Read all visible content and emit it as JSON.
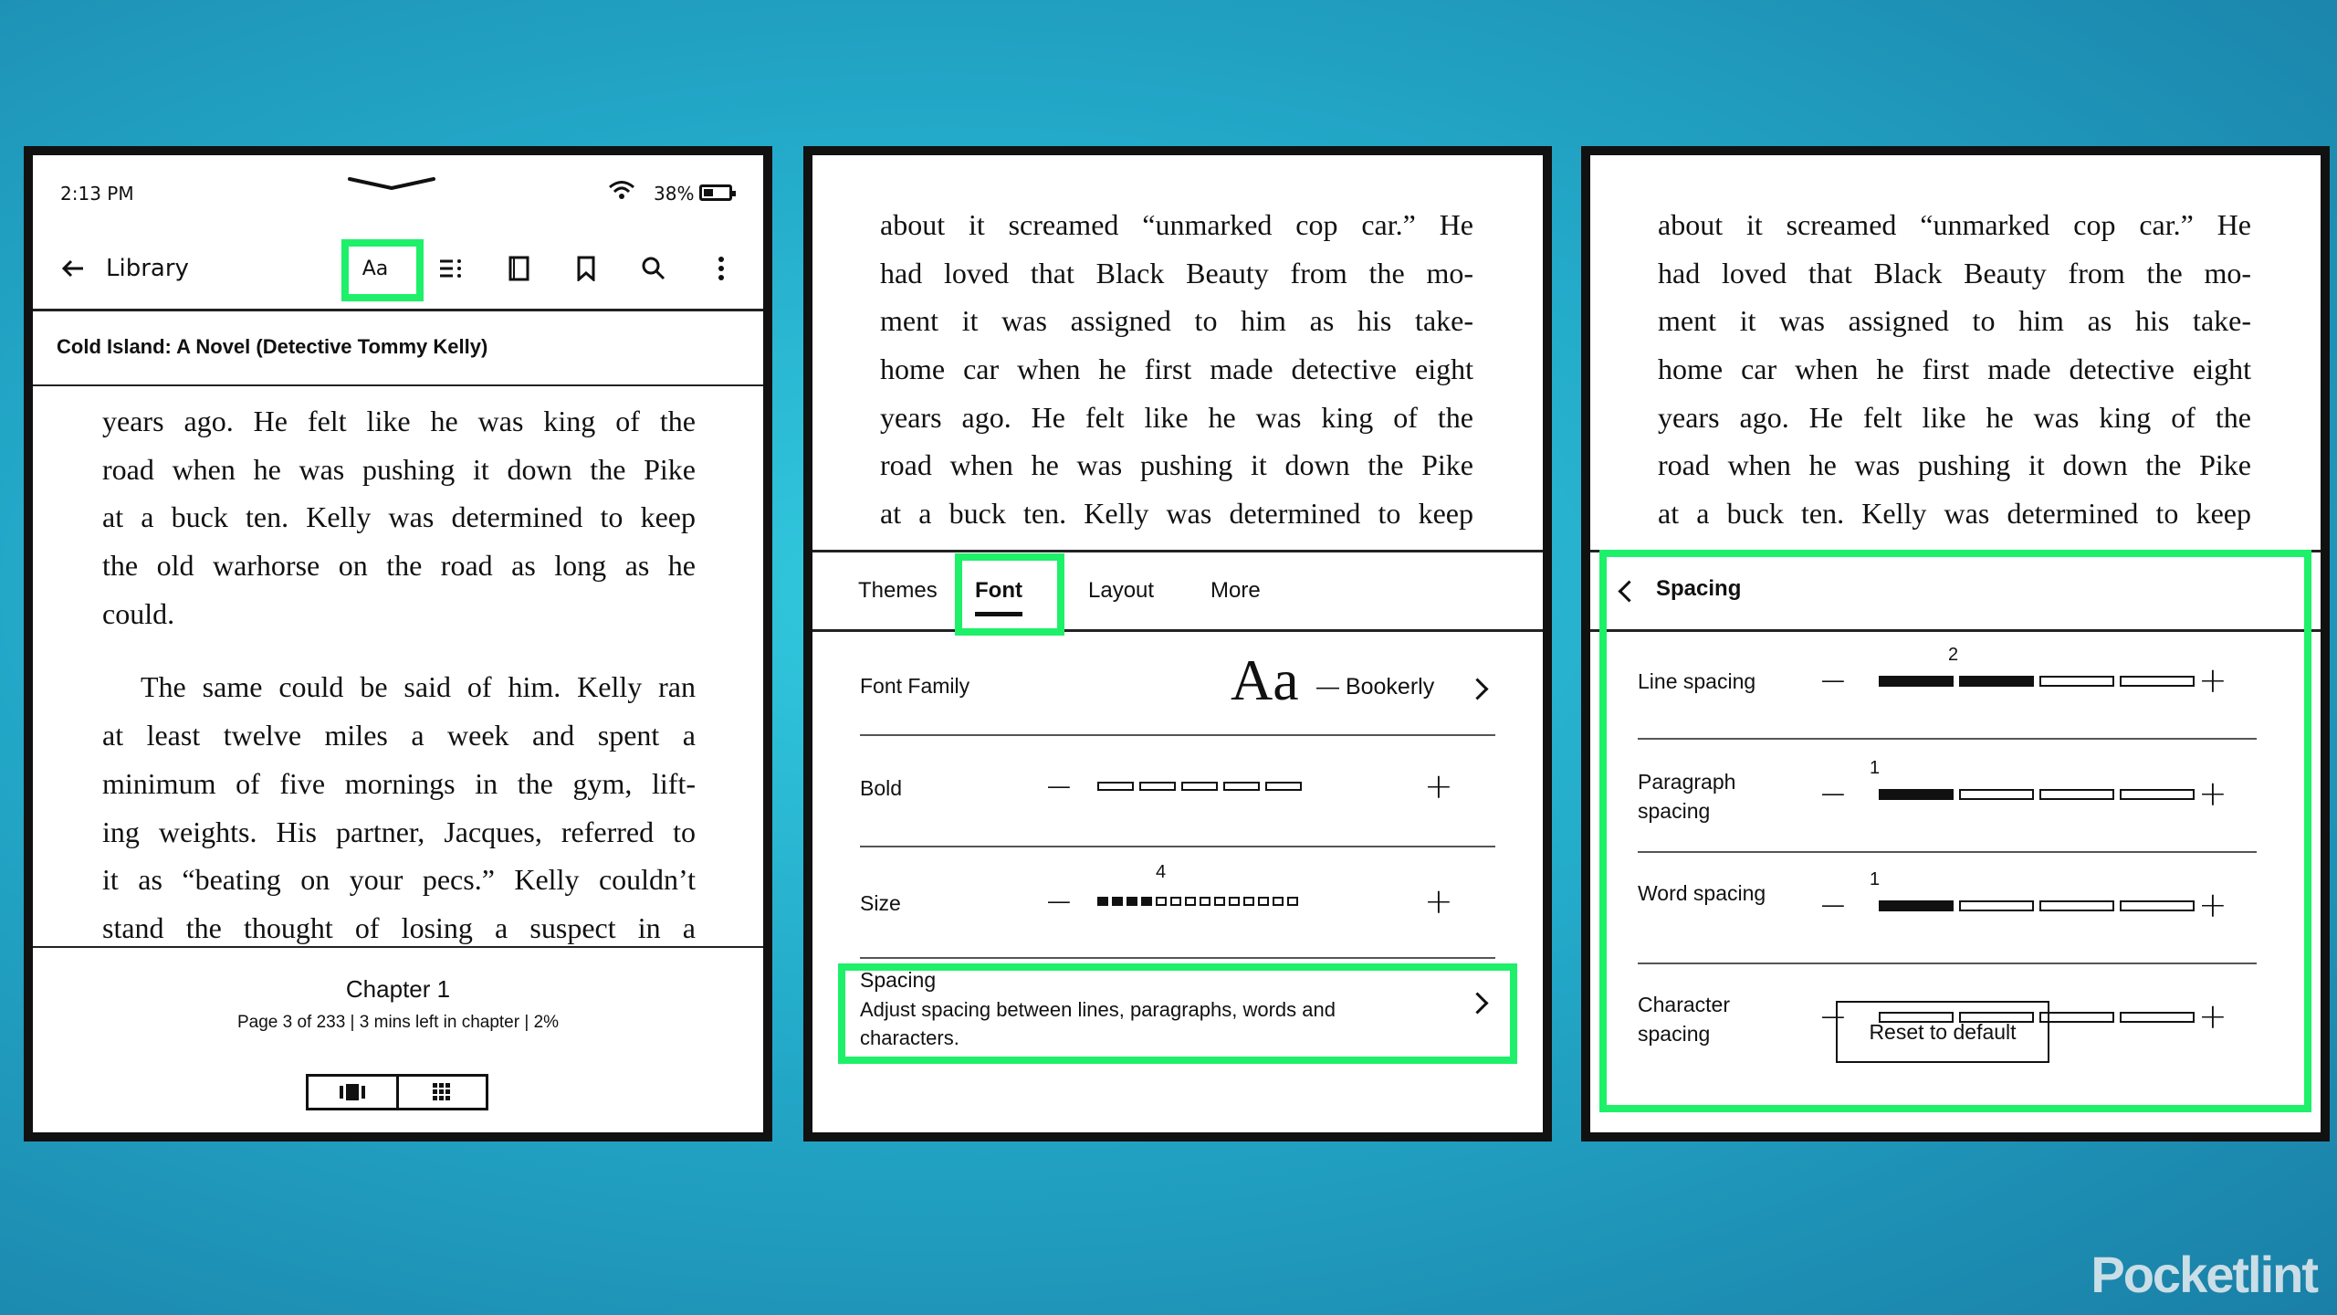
{
  "colors": {
    "highlight": "#1ef06a",
    "ink": "#111111"
  },
  "panel1": {
    "status": {
      "time": "2:13 PM",
      "battery": "38%",
      "battery_level": 0.38
    },
    "toolbar": {
      "back_label": "Library",
      "font_button": "Aa"
    },
    "book_title": "Cold Island: A Novel (Detective Tommy Kelly)",
    "para1": [
      "years ago. He felt like he was king of the",
      "road when he was pushing it down the Pike",
      "at a buck ten. Kelly was determined to keep",
      "the old warhorse on the road as long as he",
      "could."
    ],
    "para2": [
      "The same could be said of him. Kelly ran",
      "at least twelve miles a week and spent a",
      "minimum of five mornings in the gym, lift-",
      "ing weights. His partner, Jacques, referred to",
      "it as “beating on your pecs.” Kelly couldn’t",
      "stand the thought of losing a suspect in a"
    ],
    "chapter": "Chapter 1",
    "page_info": "Page 3 of 233 | 3 mins left in chapter | 2%"
  },
  "panel2": {
    "text_lines": [
      "about it screamed “unmarked cop car.” He",
      "had loved that Black Beauty from the mo-",
      "ment it was assigned to him as his take-",
      "home car when he first made detective eight",
      "years ago. He felt like he was king of the",
      "road when he was pushing it down the Pike",
      "at a buck ten. Kelly was determined to keep"
    ],
    "tabs": [
      "Themes",
      "Font",
      "Layout",
      "More"
    ],
    "font_family": {
      "label": "Font Family",
      "sample": "Aa",
      "value": "— Bookerly"
    },
    "bold": {
      "label": "Bold",
      "level": 0,
      "steps": 5
    },
    "size": {
      "label": "Size",
      "level": 4,
      "steps": 14,
      "value_label": "4"
    },
    "spacing": {
      "title": "Spacing",
      "description": "Adjust spacing between lines, paragraphs, words and characters."
    }
  },
  "panel3": {
    "text_lines": [
      "about it screamed “unmarked cop car.” He",
      "had loved that Black Beauty from the mo-",
      "ment it was assigned to him as his take-",
      "home car when he first made detective eight",
      "years ago. He felt like he was king of the",
      "road when he was pushing it down the Pike",
      "at a buck ten. Kelly was determined to keep"
    ],
    "header": "Spacing",
    "rows": [
      {
        "label": "Line spacing",
        "level": 2,
        "value_label": "2"
      },
      {
        "label": "Paragraph spacing",
        "level": 1,
        "value_label": "1"
      },
      {
        "label": "Word spacing",
        "level": 1,
        "value_label": "1"
      },
      {
        "label": "Character spacing",
        "level": 0,
        "value_label": ""
      }
    ],
    "reset_label": "Reset to default"
  },
  "watermark": "Pocketlint"
}
